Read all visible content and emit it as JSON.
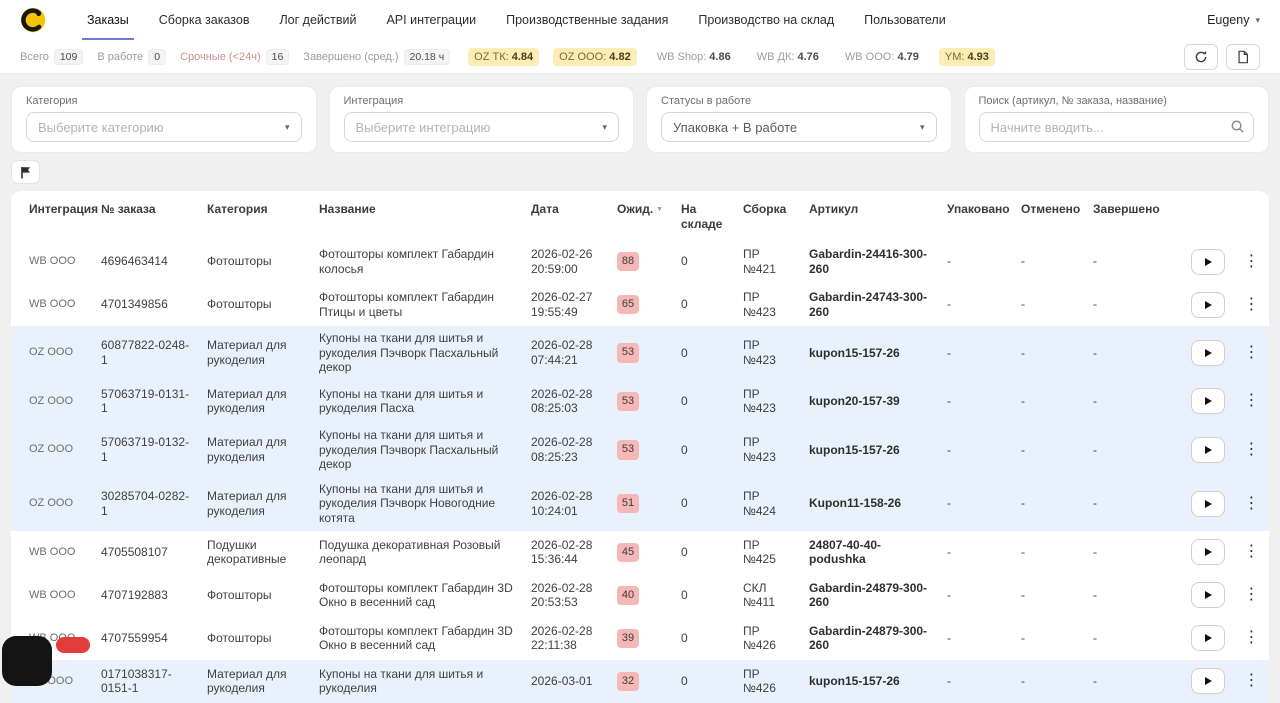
{
  "colors": {
    "page_bg": "#f0f0f1",
    "accent": "#6b7fd7",
    "row_hl": "#e9f2fc",
    "badge_bg": "#f6b7b7",
    "chip_bg": "#fcedb7",
    "brand": "#f6c500"
  },
  "nav": {
    "tabs": [
      {
        "label": "Заказы",
        "active": true
      },
      {
        "label": "Сборка заказов",
        "active": false
      },
      {
        "label": "Лог действий",
        "active": false
      },
      {
        "label": "API интеграции",
        "active": false
      },
      {
        "label": "Производственные задания",
        "active": false
      },
      {
        "label": "Производство на склад",
        "active": false
      },
      {
        "label": "Пользователи",
        "active": false
      }
    ],
    "user": "Eugeny"
  },
  "stats": {
    "counters": [
      {
        "label": "Всего",
        "value": "109",
        "tone": "default"
      },
      {
        "label": "В работе",
        "value": "0",
        "tone": "default"
      },
      {
        "label": "Срочные (<24ч)",
        "value": "16",
        "tone": "urgent"
      },
      {
        "label": "Завершено (сред.)",
        "value": "20.18 ч",
        "tone": "default"
      }
    ],
    "ratings": [
      {
        "label": "OZ ТК:",
        "value": "4.84",
        "highlighted": true
      },
      {
        "label": "OZ ООО:",
        "value": "4.82",
        "highlighted": true
      },
      {
        "label": "WB Shop:",
        "value": "4.86",
        "highlighted": false
      },
      {
        "label": "WB ДК:",
        "value": "4.76",
        "highlighted": false
      },
      {
        "label": "WB ООО:",
        "value": "4.79",
        "highlighted": false
      },
      {
        "label": "YM:",
        "value": "4.93",
        "highlighted": true
      }
    ]
  },
  "filters": [
    {
      "label": "Категория",
      "placeholder": "Выберите категорию",
      "value": ""
    },
    {
      "label": "Интеграция",
      "placeholder": "Выберите интеграцию",
      "value": ""
    },
    {
      "label": "Статусы в работе",
      "placeholder": "",
      "value": "Упаковка + В работе"
    },
    {
      "label": "Поиск (артикул, № заказа, название)",
      "placeholder": "Начните вводить...",
      "value": ""
    }
  ],
  "table": {
    "headers": [
      "Интеграция",
      "№ заказа",
      "Категория",
      "Название",
      "Дата",
      "Ожид.",
      "На складе",
      "Сборка",
      "Артикул",
      "Упаковано",
      "Отменено",
      "Завершено"
    ],
    "rows": [
      {
        "integration": "WB ООО",
        "order": "4696463414",
        "category": "Фотошторы",
        "name": "Фотошторы комплект Габардин колосья",
        "date": "2026-02-26 20:59:00",
        "wait": "88",
        "stock": "0",
        "assembly": "ПР №421",
        "article": "Gabardin-24416-300-260",
        "packed": "-",
        "cancelled": "-",
        "completed": "-",
        "highlighted": false
      },
      {
        "integration": "WB ООО",
        "order": "4701349856",
        "category": "Фотошторы",
        "name": "Фотошторы комплект Габардин Птицы и цветы",
        "date": "2026-02-27 19:55:49",
        "wait": "65",
        "stock": "0",
        "assembly": "ПР №423",
        "article": "Gabardin-24743-300-260",
        "packed": "-",
        "cancelled": "-",
        "completed": "-",
        "highlighted": false
      },
      {
        "integration": "OZ ООО",
        "order": "60877822-0248-1",
        "category": "Материал для рукоделия",
        "name": "Купоны на ткани для шитья и рукоделия Пэчворк Пасхальный декор",
        "date": "2026-02-28 07:44:21",
        "wait": "53",
        "stock": "0",
        "assembly": "ПР №423",
        "article": "kupon15-157-26",
        "packed": "-",
        "cancelled": "-",
        "completed": "-",
        "highlighted": true
      },
      {
        "integration": "OZ ООО",
        "order": "57063719-0131-1",
        "category": "Материал для рукоделия",
        "name": "Купоны на ткани для шитья и рукоделия Пасха",
        "date": "2026-02-28 08:25:03",
        "wait": "53",
        "stock": "0",
        "assembly": "ПР №423",
        "article": "kupon20-157-39",
        "packed": "-",
        "cancelled": "-",
        "completed": "-",
        "highlighted": true
      },
      {
        "integration": "OZ ООО",
        "order": "57063719-0132-1",
        "category": "Материал для рукоделия",
        "name": "Купоны на ткани для шитья и рукоделия Пэчворк Пасхальный декор",
        "date": "2026-02-28 08:25:23",
        "wait": "53",
        "stock": "0",
        "assembly": "ПР №423",
        "article": "kupon15-157-26",
        "packed": "-",
        "cancelled": "-",
        "completed": "-",
        "highlighted": true
      },
      {
        "integration": "OZ ООО",
        "order": "30285704-0282-1",
        "category": "Материал для рукоделия",
        "name": "Купоны на ткани для шитья и рукоделия Пэчворк Новогодние котята",
        "date": "2026-02-28 10:24:01",
        "wait": "51",
        "stock": "0",
        "assembly": "ПР №424",
        "article": "Kupon11-158-26",
        "packed": "-",
        "cancelled": "-",
        "completed": "-",
        "highlighted": true
      },
      {
        "integration": "WB ООО",
        "order": "4705508107",
        "category": "Подушки декоративные",
        "name": "Подушка декоративная Розовый леопард",
        "date": "2026-02-28 15:36:44",
        "wait": "45",
        "stock": "0",
        "assembly": "ПР №425",
        "article": "24807-40-40-podushka",
        "packed": "-",
        "cancelled": "-",
        "completed": "-",
        "highlighted": false
      },
      {
        "integration": "WB ООО",
        "order": "4707192883",
        "category": "Фотошторы",
        "name": "Фотошторы комплект Габардин 3D Окно в весенний сад",
        "date": "2026-02-28 20:53:53",
        "wait": "40",
        "stock": "0",
        "assembly": "СКЛ №411",
        "article": "Gabardin-24879-300-260",
        "packed": "-",
        "cancelled": "-",
        "completed": "-",
        "highlighted": false
      },
      {
        "integration": "WB ООО",
        "order": "4707559954",
        "category": "Фотошторы",
        "name": "Фотошторы комплект Габардин 3D Окно в весенний сад",
        "date": "2026-02-28 22:11:38",
        "wait": "39",
        "stock": "0",
        "assembly": "ПР №426",
        "article": "Gabardin-24879-300-260",
        "packed": "-",
        "cancelled": "-",
        "completed": "-",
        "highlighted": false
      },
      {
        "integration": "OZ ООО",
        "order": "0171038317-0151-1",
        "category": "Материал для рукоделия",
        "name": "Купоны на ткани для шитья и рукоделия",
        "date": "2026-03-01",
        "wait": "32",
        "stock": "0",
        "assembly": "ПР №426",
        "article": "kupon15-157-26",
        "packed": "-",
        "cancelled": "-",
        "completed": "-",
        "highlighted": true
      }
    ]
  },
  "icons": {
    "kebab": "⋮",
    "chevron_down": "▾",
    "sort_caret": "▼"
  }
}
